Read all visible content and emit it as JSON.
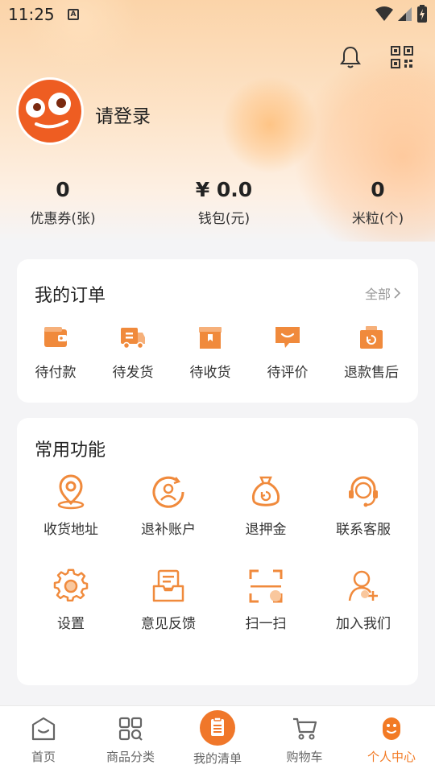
{
  "status_bar": {
    "time": "11:25"
  },
  "profile": {
    "login_text": "请登录"
  },
  "stats": [
    {
      "value": "0",
      "label": "优惠券(张)"
    },
    {
      "value": "¥ 0.0",
      "label": "钱包(元)"
    },
    {
      "value": "0",
      "label": "米粒(个)"
    }
  ],
  "orders": {
    "title": "我的订单",
    "more_label": "全部",
    "items": [
      {
        "label": "待付款",
        "icon": "wallet-icon"
      },
      {
        "label": "待发货",
        "icon": "truck-icon"
      },
      {
        "label": "待收货",
        "icon": "package-icon"
      },
      {
        "label": "待评价",
        "icon": "comment-icon"
      },
      {
        "label": "退款售后",
        "icon": "refund-icon"
      }
    ]
  },
  "functions": {
    "title": "常用功能",
    "items": [
      {
        "label": "收货地址",
        "icon": "location-icon"
      },
      {
        "label": "退补账户",
        "icon": "account-icon"
      },
      {
        "label": "退押金",
        "icon": "money-bag-icon"
      },
      {
        "label": "联系客服",
        "icon": "headset-icon"
      },
      {
        "label": "设置",
        "icon": "gear-icon"
      },
      {
        "label": "意见反馈",
        "icon": "feedback-icon"
      },
      {
        "label": "扫一扫",
        "icon": "scan-icon"
      },
      {
        "label": "加入我们",
        "icon": "add-user-icon"
      }
    ]
  },
  "tabbar": {
    "items": [
      {
        "label": "首页",
        "icon": "home-icon"
      },
      {
        "label": "商品分类",
        "icon": "category-icon"
      },
      {
        "label": "我的清单",
        "icon": "list-icon"
      },
      {
        "label": "购物车",
        "icon": "cart-icon"
      },
      {
        "label": "个人中心",
        "icon": "user-icon"
      }
    ],
    "active_index": 4
  },
  "colors": {
    "accent": "#f27a24",
    "avatar": "#ee5d22",
    "icon_orange": "#f08a3c"
  }
}
